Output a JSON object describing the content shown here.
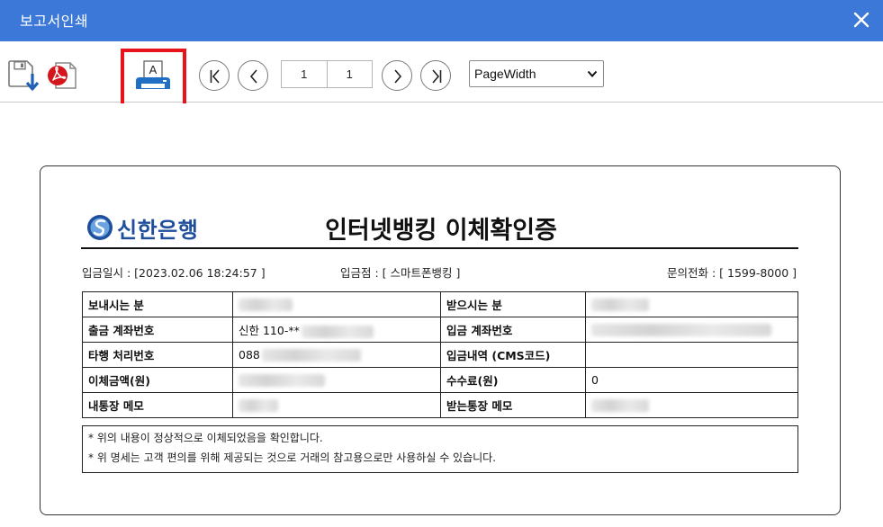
{
  "window": {
    "title": "보고서인쇄"
  },
  "toolbar": {
    "page_current": "1",
    "page_total": "1",
    "zoom_selected": "PageWidth",
    "highlight_color": "#e8141b",
    "accent_color": "#3c78d8"
  },
  "report": {
    "bank_name": "신한은행",
    "title": "인터넷뱅킹 이체확인증",
    "deposit_datetime": "입금일시 : [2023.02.06 18:24:57 ]",
    "deposit_branch": "입금점 : [ 스마트폰뱅킹 ]",
    "inquiry_phone": "문의전화 : [ 1599-8000 ]",
    "rows": [
      {
        "label1": "보내시는 분",
        "value1": "",
        "label2": "받으시는 분",
        "value2": ""
      },
      {
        "label1": "출금 계좌번호",
        "value1": "신한 110-**",
        "label2": "입금 계좌번호",
        "value2": ""
      },
      {
        "label1": "타행 처리번호",
        "value1": "088",
        "label2": "입금내역 (CMS코드)",
        "value2": ""
      },
      {
        "label1": "이체금액(원)",
        "value1": "",
        "label2": "수수료(원)",
        "value2": "0"
      },
      {
        "label1": "내통장 메모",
        "value1": "",
        "label2": "받는통장 메모",
        "value2": ""
      }
    ],
    "notes": [
      "* 위의 내용이 정상적으로 이체되었음을 확인합니다.",
      "* 위 명세는 고객 편의를 위해 제공되는 것으로 거래의 참고용으로만 사용하실 수 있습니다."
    ]
  }
}
